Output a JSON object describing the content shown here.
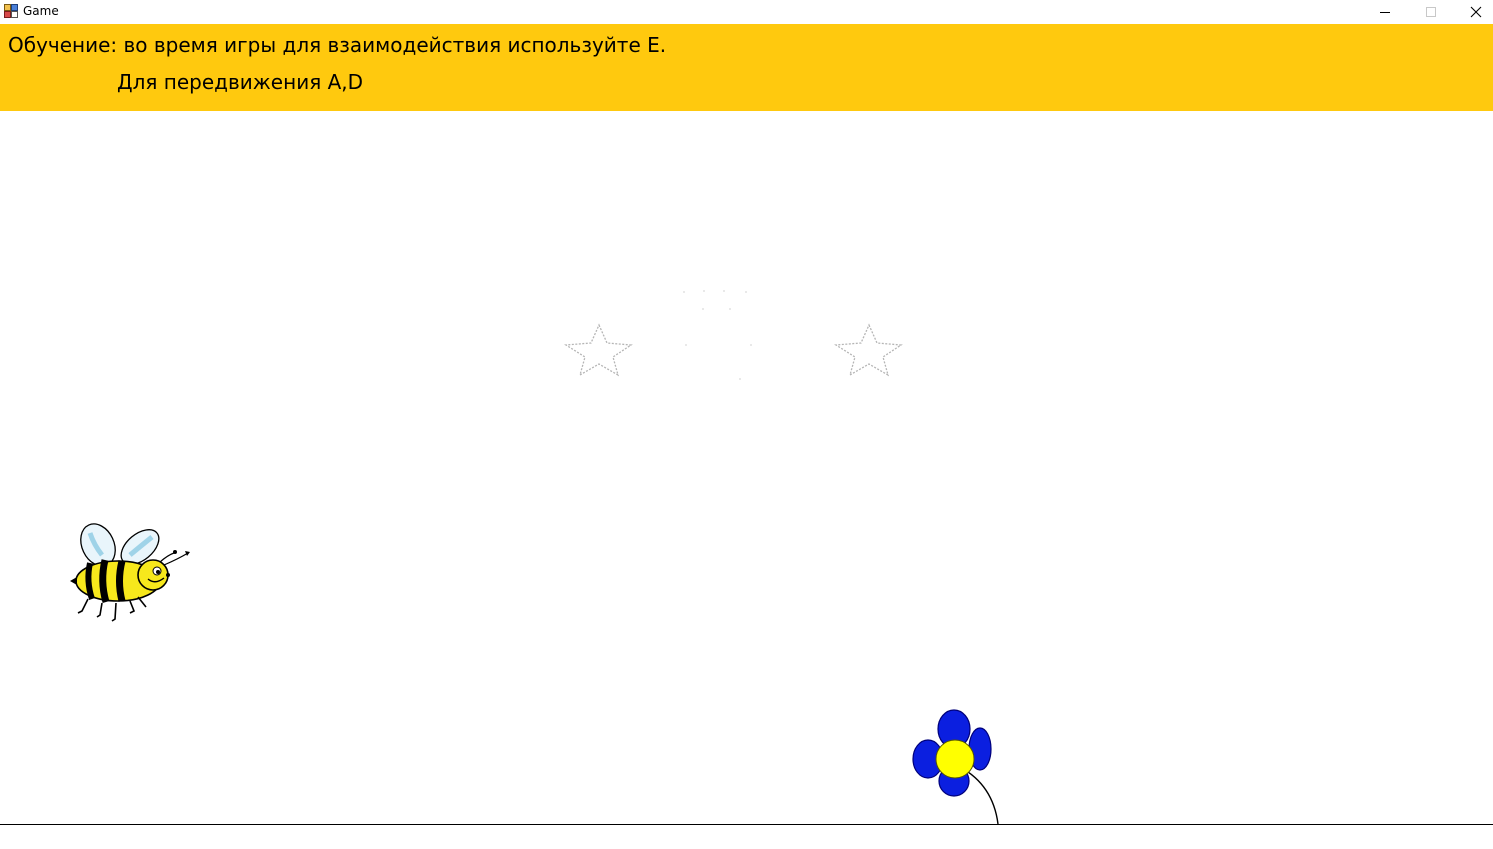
{
  "window": {
    "title": "Game",
    "icon": "app-window-icon",
    "controls": {
      "minimize": "minimize-icon",
      "maximize": "maximize-icon",
      "close": "close-icon"
    }
  },
  "tutorial": {
    "line1": "Обучение: во время игры для взаимодействия используйте E.",
    "line2": "Для передвижения A,D",
    "background_color": "#ffc90e"
  },
  "rating": {
    "total_stars": 3,
    "earned_stars": 0
  },
  "scene": {
    "player": "bee-sprite",
    "target": "flower-sprite",
    "flower_petal_color": "#0b1fe0",
    "flower_center_color": "#ffff00"
  }
}
